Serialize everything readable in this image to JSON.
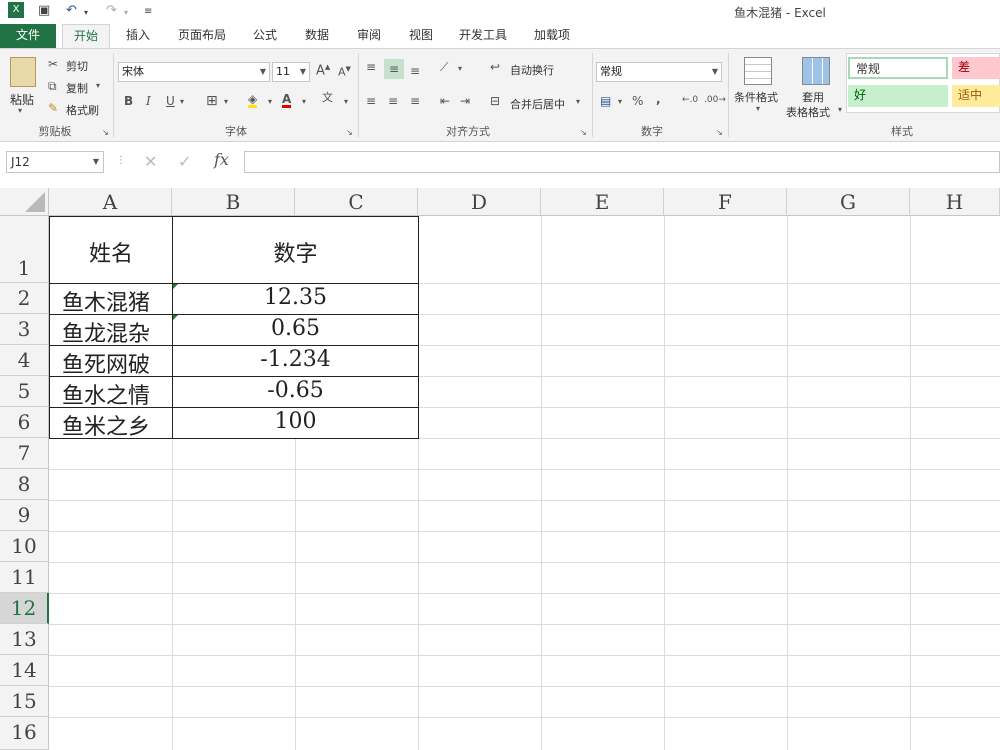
{
  "window": {
    "title": "鱼木混猪 - Excel"
  },
  "ribbon": {
    "tabs": [
      "文件",
      "开始",
      "插入",
      "页面布局",
      "公式",
      "数据",
      "审阅",
      "视图",
      "开发工具",
      "加载项"
    ],
    "clipboard": {
      "paste": "粘贴",
      "cut": "剪切",
      "copy": "复制",
      "format_painter": "格式刷",
      "label": "剪贴板"
    },
    "font": {
      "name": "宋体",
      "size": "11",
      "label": "字体"
    },
    "alignment": {
      "wrap": "自动换行",
      "merge": "合并后居中",
      "label": "对齐方式"
    },
    "number": {
      "format": "常规",
      "label": "数字"
    },
    "styles": {
      "conditional": "条件格式",
      "table_line1": "套用",
      "table_line2": "表格格式",
      "normal": "常规",
      "bad": "差",
      "good": "好",
      "neutral": "适中",
      "label": "样式"
    }
  },
  "formula_bar": {
    "name_box": "J12",
    "fx": "fx",
    "value": ""
  },
  "grid": {
    "columns": [
      "A",
      "B",
      "C",
      "D",
      "E",
      "F",
      "G",
      "H"
    ],
    "rows": [
      "1",
      "2",
      "3",
      "4",
      "5",
      "6",
      "7",
      "8",
      "9",
      "10",
      "11",
      "12",
      "13",
      "14",
      "15",
      "16"
    ],
    "selected_row": "12",
    "header": {
      "name": "姓名",
      "number": "数字"
    },
    "table": [
      {
        "name": "鱼木混猪",
        "value": "12.35"
      },
      {
        "name": "鱼龙混杂",
        "value": "0.65"
      },
      {
        "name": "鱼死网破",
        "value": "-1.234"
      },
      {
        "name": "鱼水之情",
        "value": "-0.65"
      },
      {
        "name": "鱼米之乡",
        "value": "100"
      }
    ]
  },
  "colors": {
    "accent": "#217346",
    "style_bad_bg": "#ffc7ce",
    "style_good_bg": "#c6efce",
    "style_neutral_bg": "#ffeb9c"
  }
}
